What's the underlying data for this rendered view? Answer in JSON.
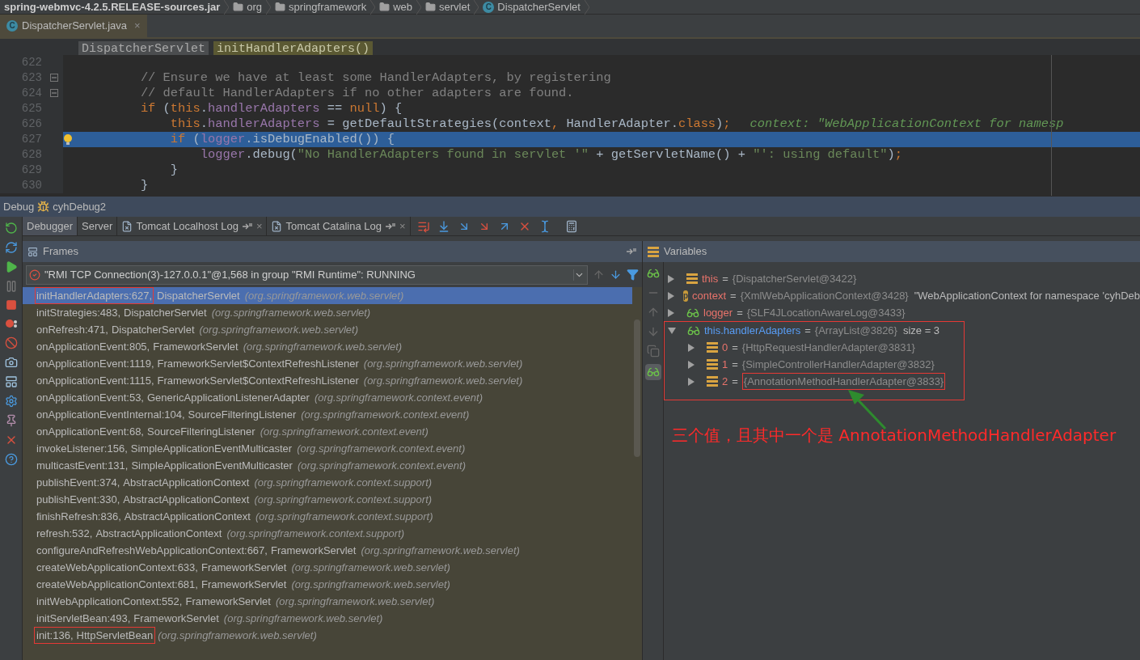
{
  "breadcrumb": [
    {
      "kind": "jar",
      "label": "spring-webmvc-4.2.5.RELEASE-sources.jar"
    },
    {
      "kind": "folder",
      "label": "org"
    },
    {
      "kind": "folder",
      "label": "springframework"
    },
    {
      "kind": "folder",
      "label": "web"
    },
    {
      "kind": "folder",
      "label": "servlet"
    },
    {
      "kind": "class",
      "label": "DispatcherServlet",
      "icon_letter": "C"
    }
  ],
  "editor_tabs": [
    {
      "label": "DispatcherServlet.java",
      "icon_letter": "C",
      "selected": true,
      "close": "×"
    }
  ],
  "structure_path": [
    {
      "label": "DispatcherServlet",
      "selected": false
    },
    {
      "label": "initHandlerAdapters()",
      "selected": true
    }
  ],
  "code": {
    "lines": [
      {
        "number": "622"
      },
      {
        "number": "623",
        "fold": true,
        "tokens": [
          {
            "kind": "comment",
            "text": "        // Ensure we have at least some HandlerAdapters, by registering"
          }
        ]
      },
      {
        "number": "624",
        "fold": true,
        "tokens": [
          {
            "kind": "comment",
            "text": "        // default HandlerAdapters if no other adapters are found."
          }
        ]
      },
      {
        "number": "625",
        "tokens": [
          {
            "kind": "keyword",
            "text": "        if"
          },
          {
            "kind": "plain",
            "text": " ("
          },
          {
            "kind": "keyword",
            "text": "this"
          },
          {
            "kind": "plain",
            "text": "."
          },
          {
            "kind": "field",
            "text": "handlerAdapters"
          },
          {
            "kind": "plain",
            "text": " == "
          },
          {
            "kind": "keyword",
            "text": "null"
          },
          {
            "kind": "plain",
            "text": ") {"
          }
        ]
      },
      {
        "number": "626",
        "tokens": [
          {
            "kind": "keyword",
            "text": "            this"
          },
          {
            "kind": "plain",
            "text": "."
          },
          {
            "kind": "field",
            "text": "handlerAdapters"
          },
          {
            "kind": "plain",
            "text": " = getDefaultStrategies(context"
          },
          {
            "kind": "keyword",
            "text": ","
          },
          {
            "kind": "plain",
            "text": " HandlerAdapter."
          },
          {
            "kind": "keyword",
            "text": "class"
          },
          {
            "kind": "plain",
            "text": ")"
          },
          {
            "kind": "keyword",
            "text": ";"
          }
        ],
        "hint": "context: \"WebApplicationContext for namesp"
      },
      {
        "number": "627",
        "current": true,
        "intention": true,
        "tokens": [
          {
            "kind": "keyword",
            "text": "            if"
          },
          {
            "kind": "plain",
            "text": " ("
          },
          {
            "kind": "field",
            "text": "logger"
          },
          {
            "kind": "plain",
            "text": ".isDebugEnabled()) {"
          }
        ]
      },
      {
        "number": "628",
        "tokens": [
          {
            "kind": "field",
            "text": "                logger"
          },
          {
            "kind": "plain",
            "text": ".debug("
          },
          {
            "kind": "string",
            "text": "\"No HandlerAdapters found in servlet '\""
          },
          {
            "kind": "plain",
            "text": " + getServletName() + "
          },
          {
            "kind": "string",
            "text": "\"': using default\""
          },
          {
            "kind": "plain",
            "text": ")"
          },
          {
            "kind": "keyword",
            "text": ";"
          }
        ]
      },
      {
        "number": "629",
        "tokens": [
          {
            "kind": "plain",
            "text": "            }"
          }
        ]
      },
      {
        "number": "630",
        "tokens": [
          {
            "kind": "plain",
            "text": "        }"
          }
        ]
      }
    ]
  },
  "debug": {
    "title": "Debug",
    "config": "cyhDebug2",
    "tabs": [
      {
        "label": "Debugger",
        "selected": true
      },
      {
        "label": "Server",
        "selected": false
      },
      {
        "label": "Tomcat Localhost Log",
        "selected": false,
        "pinned": true,
        "close": "×"
      },
      {
        "label": "Tomcat Catalina Log",
        "selected": false,
        "pinned": true,
        "close": "×"
      }
    ]
  },
  "frames": {
    "title": "Frames",
    "thread": "\"RMI TCP Connection(3)-127.0.0.1\"@1,568 in group \"RMI Runtime\": RUNNING",
    "items": [
      {
        "location": "initHandlerAdapters:627,",
        "class": "DispatcherServlet",
        "package": "(org.springframework.web.servlet)",
        "selected": true,
        "location_boxed": true,
        "boxed": false
      },
      {
        "location": "initStrategies:483,",
        "class": "DispatcherServlet",
        "package": "(org.springframework.web.servlet)",
        "selected": false
      },
      {
        "location": "onRefresh:471,",
        "class": "DispatcherServlet",
        "package": "(org.springframework.web.servlet)",
        "selected": false
      },
      {
        "location": "onApplicationEvent:805,",
        "class": "FrameworkServlet",
        "package": "(org.springframework.web.servlet)",
        "selected": false
      },
      {
        "location": "onApplicationEvent:1119,",
        "class": "FrameworkServlet$ContextRefreshListener",
        "package": "(org.springframework.web.servlet)",
        "selected": false
      },
      {
        "location": "onApplicationEvent:1115,",
        "class": "FrameworkServlet$ContextRefreshListener",
        "package": "(org.springframework.web.servlet)",
        "selected": false
      },
      {
        "location": "onApplicationEvent:53,",
        "class": "GenericApplicationListenerAdapter",
        "package": "(org.springframework.context.event)",
        "selected": false
      },
      {
        "location": "onApplicationEventInternal:104,",
        "class": "SourceFilteringListener",
        "package": "(org.springframework.context.event)",
        "selected": false
      },
      {
        "location": "onApplicationEvent:68,",
        "class": "SourceFilteringListener",
        "package": "(org.springframework.context.event)",
        "selected": false
      },
      {
        "location": "invokeListener:156,",
        "class": "SimpleApplicationEventMulticaster",
        "package": "(org.springframework.context.event)",
        "selected": false
      },
      {
        "location": "multicastEvent:131,",
        "class": "SimpleApplicationEventMulticaster",
        "package": "(org.springframework.context.event)",
        "selected": false
      },
      {
        "location": "publishEvent:374,",
        "class": "AbstractApplicationContext",
        "package": "(org.springframework.context.support)",
        "selected": false
      },
      {
        "location": "publishEvent:330,",
        "class": "AbstractApplicationContext",
        "package": "(org.springframework.context.support)",
        "selected": false
      },
      {
        "location": "finishRefresh:836,",
        "class": "AbstractApplicationContext",
        "package": "(org.springframework.context.support)",
        "selected": false
      },
      {
        "location": "refresh:532,",
        "class": "AbstractApplicationContext",
        "package": "(org.springframework.context.support)",
        "selected": false
      },
      {
        "location": "configureAndRefreshWebApplicationContext:667,",
        "class": "FrameworkServlet",
        "package": "(org.springframework.web.servlet)",
        "selected": false
      },
      {
        "location": "createWebApplicationContext:633,",
        "class": "FrameworkServlet",
        "package": "(org.springframework.web.servlet)",
        "selected": false
      },
      {
        "location": "createWebApplicationContext:681,",
        "class": "FrameworkServlet",
        "package": "(org.springframework.web.servlet)",
        "selected": false
      },
      {
        "location": "initWebApplicationContext:552,",
        "class": "FrameworkServlet",
        "package": "(org.springframework.web.servlet)",
        "selected": false
      },
      {
        "location": "initServletBean:493,",
        "class": "FrameworkServlet",
        "package": "(org.springframework.web.servlet)",
        "selected": false
      },
      {
        "location": "init:136,",
        "class": "HttpServletBean",
        "package": "(org.springframework.web.servlet)",
        "selected": false,
        "location_boxed": false,
        "boxed": true
      }
    ]
  },
  "variables": {
    "title": "Variables",
    "items": [
      {
        "kind": "field",
        "name": "this",
        "operator": "=",
        "value": "{DispatcherServlet@3422}",
        "expanded": false,
        "changed": false,
        "boxed": false
      },
      {
        "kind": "param",
        "icon_letter": "p",
        "name": "context",
        "operator": "=",
        "value": "{XmlWebApplicationContext@3428}",
        "extra": "\"WebApplicationContext for namespace 'cyhDeb",
        "expanded": false,
        "changed": false,
        "boxed": false
      },
      {
        "kind": "watch",
        "name": "logger",
        "operator": "=",
        "value": "{SLF4JLocationAwareLog@3433}",
        "expanded": false,
        "changed": false,
        "boxed": false
      },
      {
        "kind": "watch",
        "name": "this.handlerAdapters",
        "operator": "=",
        "value": "{ArrayList@3826}",
        "extra": "size = 3",
        "expanded": true,
        "changed": true,
        "boxed": true,
        "children": [
          {
            "kind": "field",
            "name": "0",
            "operator": "=",
            "value": "{HttpRequestHandlerAdapter@3831}",
            "expanded": false,
            "changed": false,
            "value_boxed": false
          },
          {
            "kind": "field",
            "name": "1",
            "operator": "=",
            "value": "{SimpleControllerHandlerAdapter@3832}",
            "expanded": false,
            "changed": false,
            "value_boxed": false
          },
          {
            "kind": "field",
            "name": "2",
            "operator": "=",
            "value": "{AnnotationMethodHandlerAdapter@3833}",
            "expanded": false,
            "changed": false,
            "value_boxed": true
          }
        ]
      }
    ]
  },
  "annotation": {
    "caption": "三个值，且其中一个是 AnnotationMethodHandlerAdapter"
  }
}
